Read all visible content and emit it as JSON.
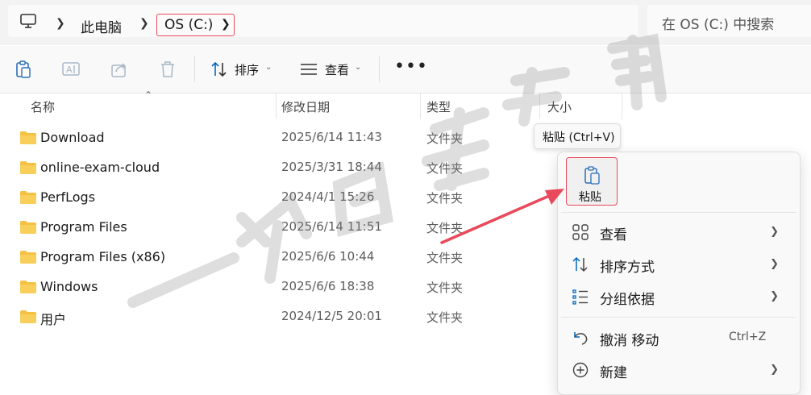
{
  "address": {
    "crumb_pc": "此电脑",
    "crumb_drive": "OS (C:)",
    "search_placeholder": "在 OS (C:) 中搜索"
  },
  "toolbar": {
    "sort_label": "排序",
    "view_label": "查看",
    "more_label": "•••"
  },
  "columns": {
    "name": "名称",
    "modified": "修改日期",
    "type": "类型",
    "size": "大小"
  },
  "files": [
    {
      "name": "Download",
      "modified": "2025/6/14 11:43",
      "type": "文件夹"
    },
    {
      "name": "online-exam-cloud",
      "modified": "2025/3/31 18:44",
      "type": "文件夹"
    },
    {
      "name": "PerfLogs",
      "modified": "2024/4/1 15:26",
      "type": "文件夹"
    },
    {
      "name": "Program Files",
      "modified": "2025/6/14 11:51",
      "type": "文件夹"
    },
    {
      "name": "Program Files (x86)",
      "modified": "2025/6/6 10:44",
      "type": "文件夹"
    },
    {
      "name": "Windows",
      "modified": "2025/6/6 18:38",
      "type": "文件夹"
    },
    {
      "name": "用户",
      "modified": "2024/12/5 20:01",
      "type": "文件夹"
    }
  ],
  "tooltip": "粘贴 (Ctrl+V)",
  "context_menu": {
    "paste_label": "粘贴",
    "items": [
      {
        "label": "查看",
        "icon": "grid-icon",
        "submenu": true
      },
      {
        "label": "排序方式",
        "icon": "sort-icon",
        "submenu": true
      },
      {
        "label": "分组依据",
        "icon": "group-list-icon",
        "submenu": true
      },
      {
        "label": "撤消 移动",
        "icon": "undo-icon",
        "shortcut": "Ctrl+Z"
      },
      {
        "label": "新建",
        "icon": "new-plus-icon",
        "submenu": true
      }
    ]
  },
  "colors": {
    "highlight_border": "#e8495b",
    "arrow": "#e8495b",
    "folder": "#f5c143",
    "accent_blue": "#0067c0"
  }
}
